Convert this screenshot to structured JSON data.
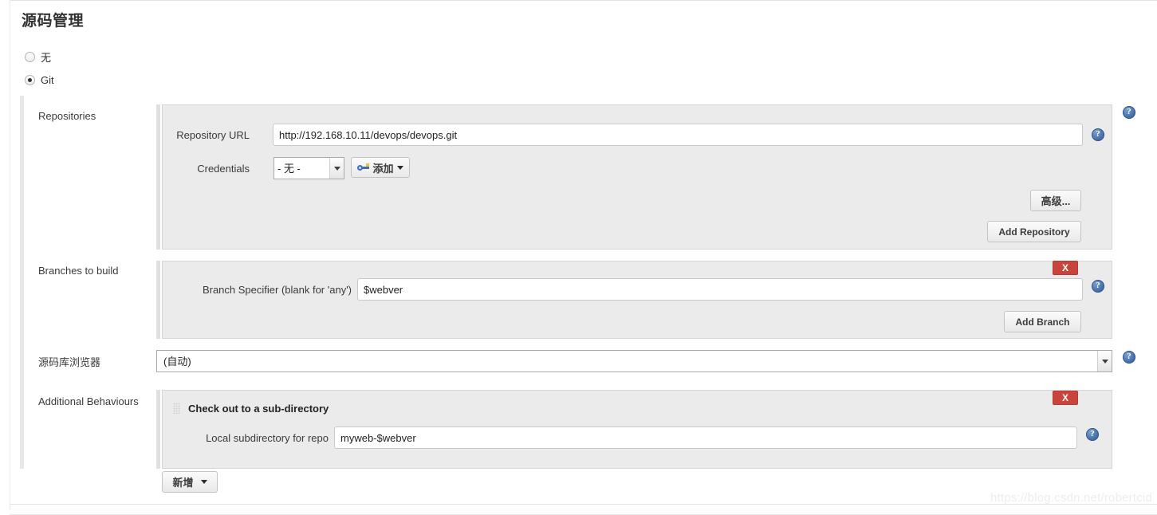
{
  "page": {
    "title": "源码管理",
    "watermark": "https://blog.csdn.net/robertcid"
  },
  "scm_options": [
    {
      "label": "无",
      "selected": false
    },
    {
      "label": "Git",
      "selected": true
    }
  ],
  "sections": {
    "repositories": {
      "label": "Repositories",
      "repository_url": {
        "label": "Repository URL",
        "value": "http://192.168.10.11/devops/devops.git"
      },
      "credentials": {
        "label": "Credentials",
        "selected": "- 无 -",
        "options": [
          "- 无 -"
        ],
        "add_button": "添加"
      },
      "advanced_button": "高级...",
      "add_repository_button": "Add Repository"
    },
    "branches": {
      "label": "Branches to build",
      "branch_specifier": {
        "label": "Branch Specifier (blank for 'any')",
        "value": "$webver"
      },
      "delete_button": "X",
      "add_branch_button": "Add Branch"
    },
    "repo_browser": {
      "label": "源码库浏览器",
      "selected": "(自动)",
      "options": [
        "(自动)"
      ]
    },
    "additional_behaviours": {
      "label": "Additional Behaviours",
      "behaviour": {
        "title": "Check out to a sub-directory",
        "delete_button": "X",
        "local_subdirectory": {
          "label": "Local subdirectory for repo",
          "value": "myweb-$webver"
        }
      },
      "add_button": "新增"
    }
  },
  "icons": {
    "help": "?",
    "key": "key-icon",
    "grip": "drag-grip-icon"
  }
}
